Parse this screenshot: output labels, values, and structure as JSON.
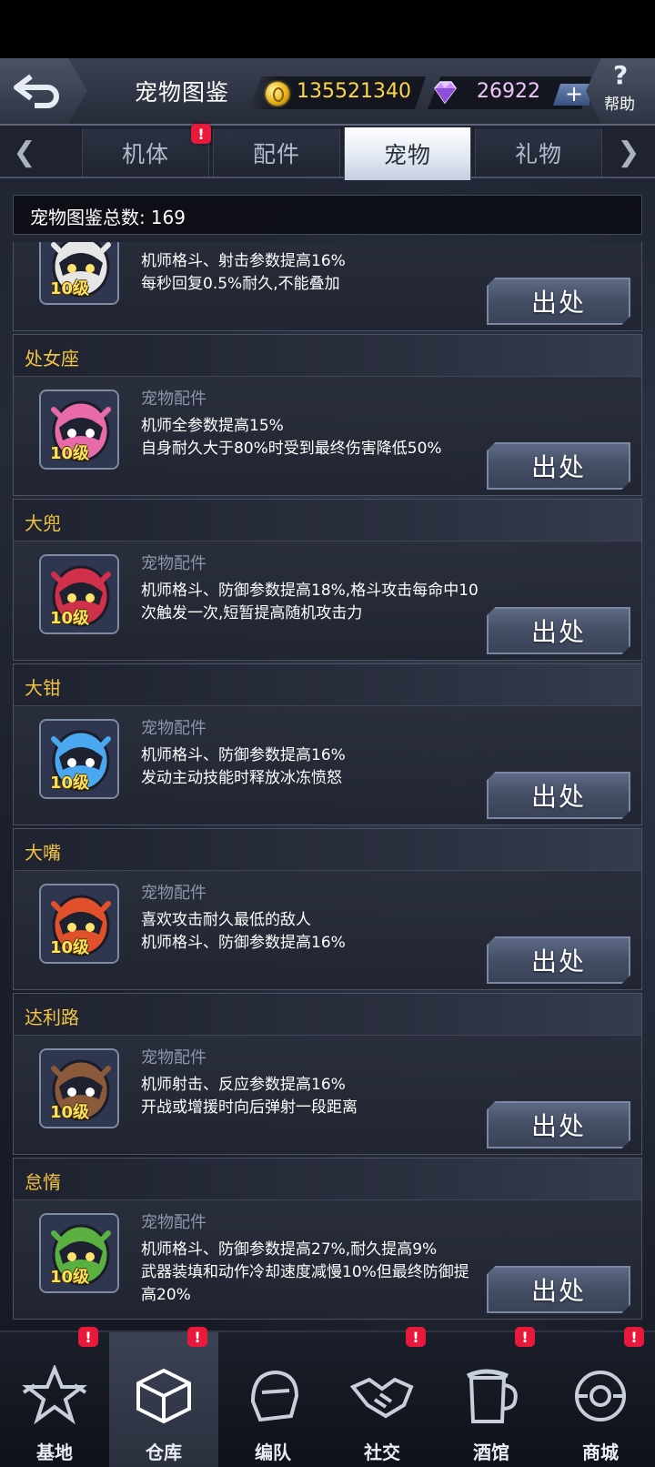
{
  "header": {
    "title": "宠物图鉴",
    "gold": "135521340",
    "gems": "26922",
    "plus_label": "+",
    "help_label": "帮助",
    "help_symbol": "?"
  },
  "tabs": [
    {
      "label": "机体",
      "badge": "!"
    },
    {
      "label": "配件"
    },
    {
      "label": "宠物",
      "active": true
    },
    {
      "label": "礼物"
    }
  ],
  "total": {
    "label": "宠物图鉴总数:",
    "count": "169"
  },
  "pets": [
    {
      "name": "",
      "level": "10级",
      "type": "",
      "desc": "机师格斗、射击参数提高16%\n每秒回复0.5%耐久,不能叠加",
      "button": "出处",
      "accent": "#e6e6e6"
    },
    {
      "name": "处女座",
      "level": "10级",
      "type": "宠物配件",
      "desc": "机师全参数提高15%\n自身耐久大于80%时受到最终伤害降低50%",
      "button": "出处",
      "accent": "#e86aa8"
    },
    {
      "name": "大兜",
      "level": "10级",
      "type": "宠物配件",
      "desc": "机师格斗、防御参数提高18%,格斗攻击每命中10次触发一次,短暂提高随机攻击力",
      "button": "出处",
      "accent": "#d0304a"
    },
    {
      "name": "大钳",
      "level": "10级",
      "type": "宠物配件",
      "desc": "机师格斗、防御参数提高16%\n发动主动技能时释放冰冻愤怒",
      "button": "出处",
      "accent": "#4aa8f0"
    },
    {
      "name": "大嘴",
      "level": "10级",
      "type": "宠物配件",
      "desc": "喜欢攻击耐久最低的敌人\n机师格斗、防御参数提高16%",
      "button": "出处",
      "accent": "#e0502a"
    },
    {
      "name": "达利路",
      "level": "10级",
      "type": "宠物配件",
      "desc": "机师射击、反应参数提高16%\n开战或增援时向后弹射一段距离",
      "button": "出处",
      "accent": "#8a5a3a"
    },
    {
      "name": "怠惰",
      "level": "10级",
      "type": "宠物配件",
      "desc": "机师格斗、防御参数提高27%,耐久提高9%\n武器装填和动作冷却速度减慢10%但最终防御提高20%",
      "button": "出处",
      "accent": "#5ab040"
    }
  ],
  "nav": [
    {
      "label": "基地",
      "badge": "!"
    },
    {
      "label": "仓库",
      "badge": "!",
      "active": true
    },
    {
      "label": "编队"
    },
    {
      "label": "社交",
      "badge": "!"
    },
    {
      "label": "酒馆",
      "badge": "!"
    },
    {
      "label": "商城",
      "badge": "!"
    }
  ],
  "colors": {
    "accent_gold": "#f2c343",
    "badge_red": "#e8193a",
    "gold_text": "#ffd54a",
    "gem_text": "#f1c6ff"
  }
}
